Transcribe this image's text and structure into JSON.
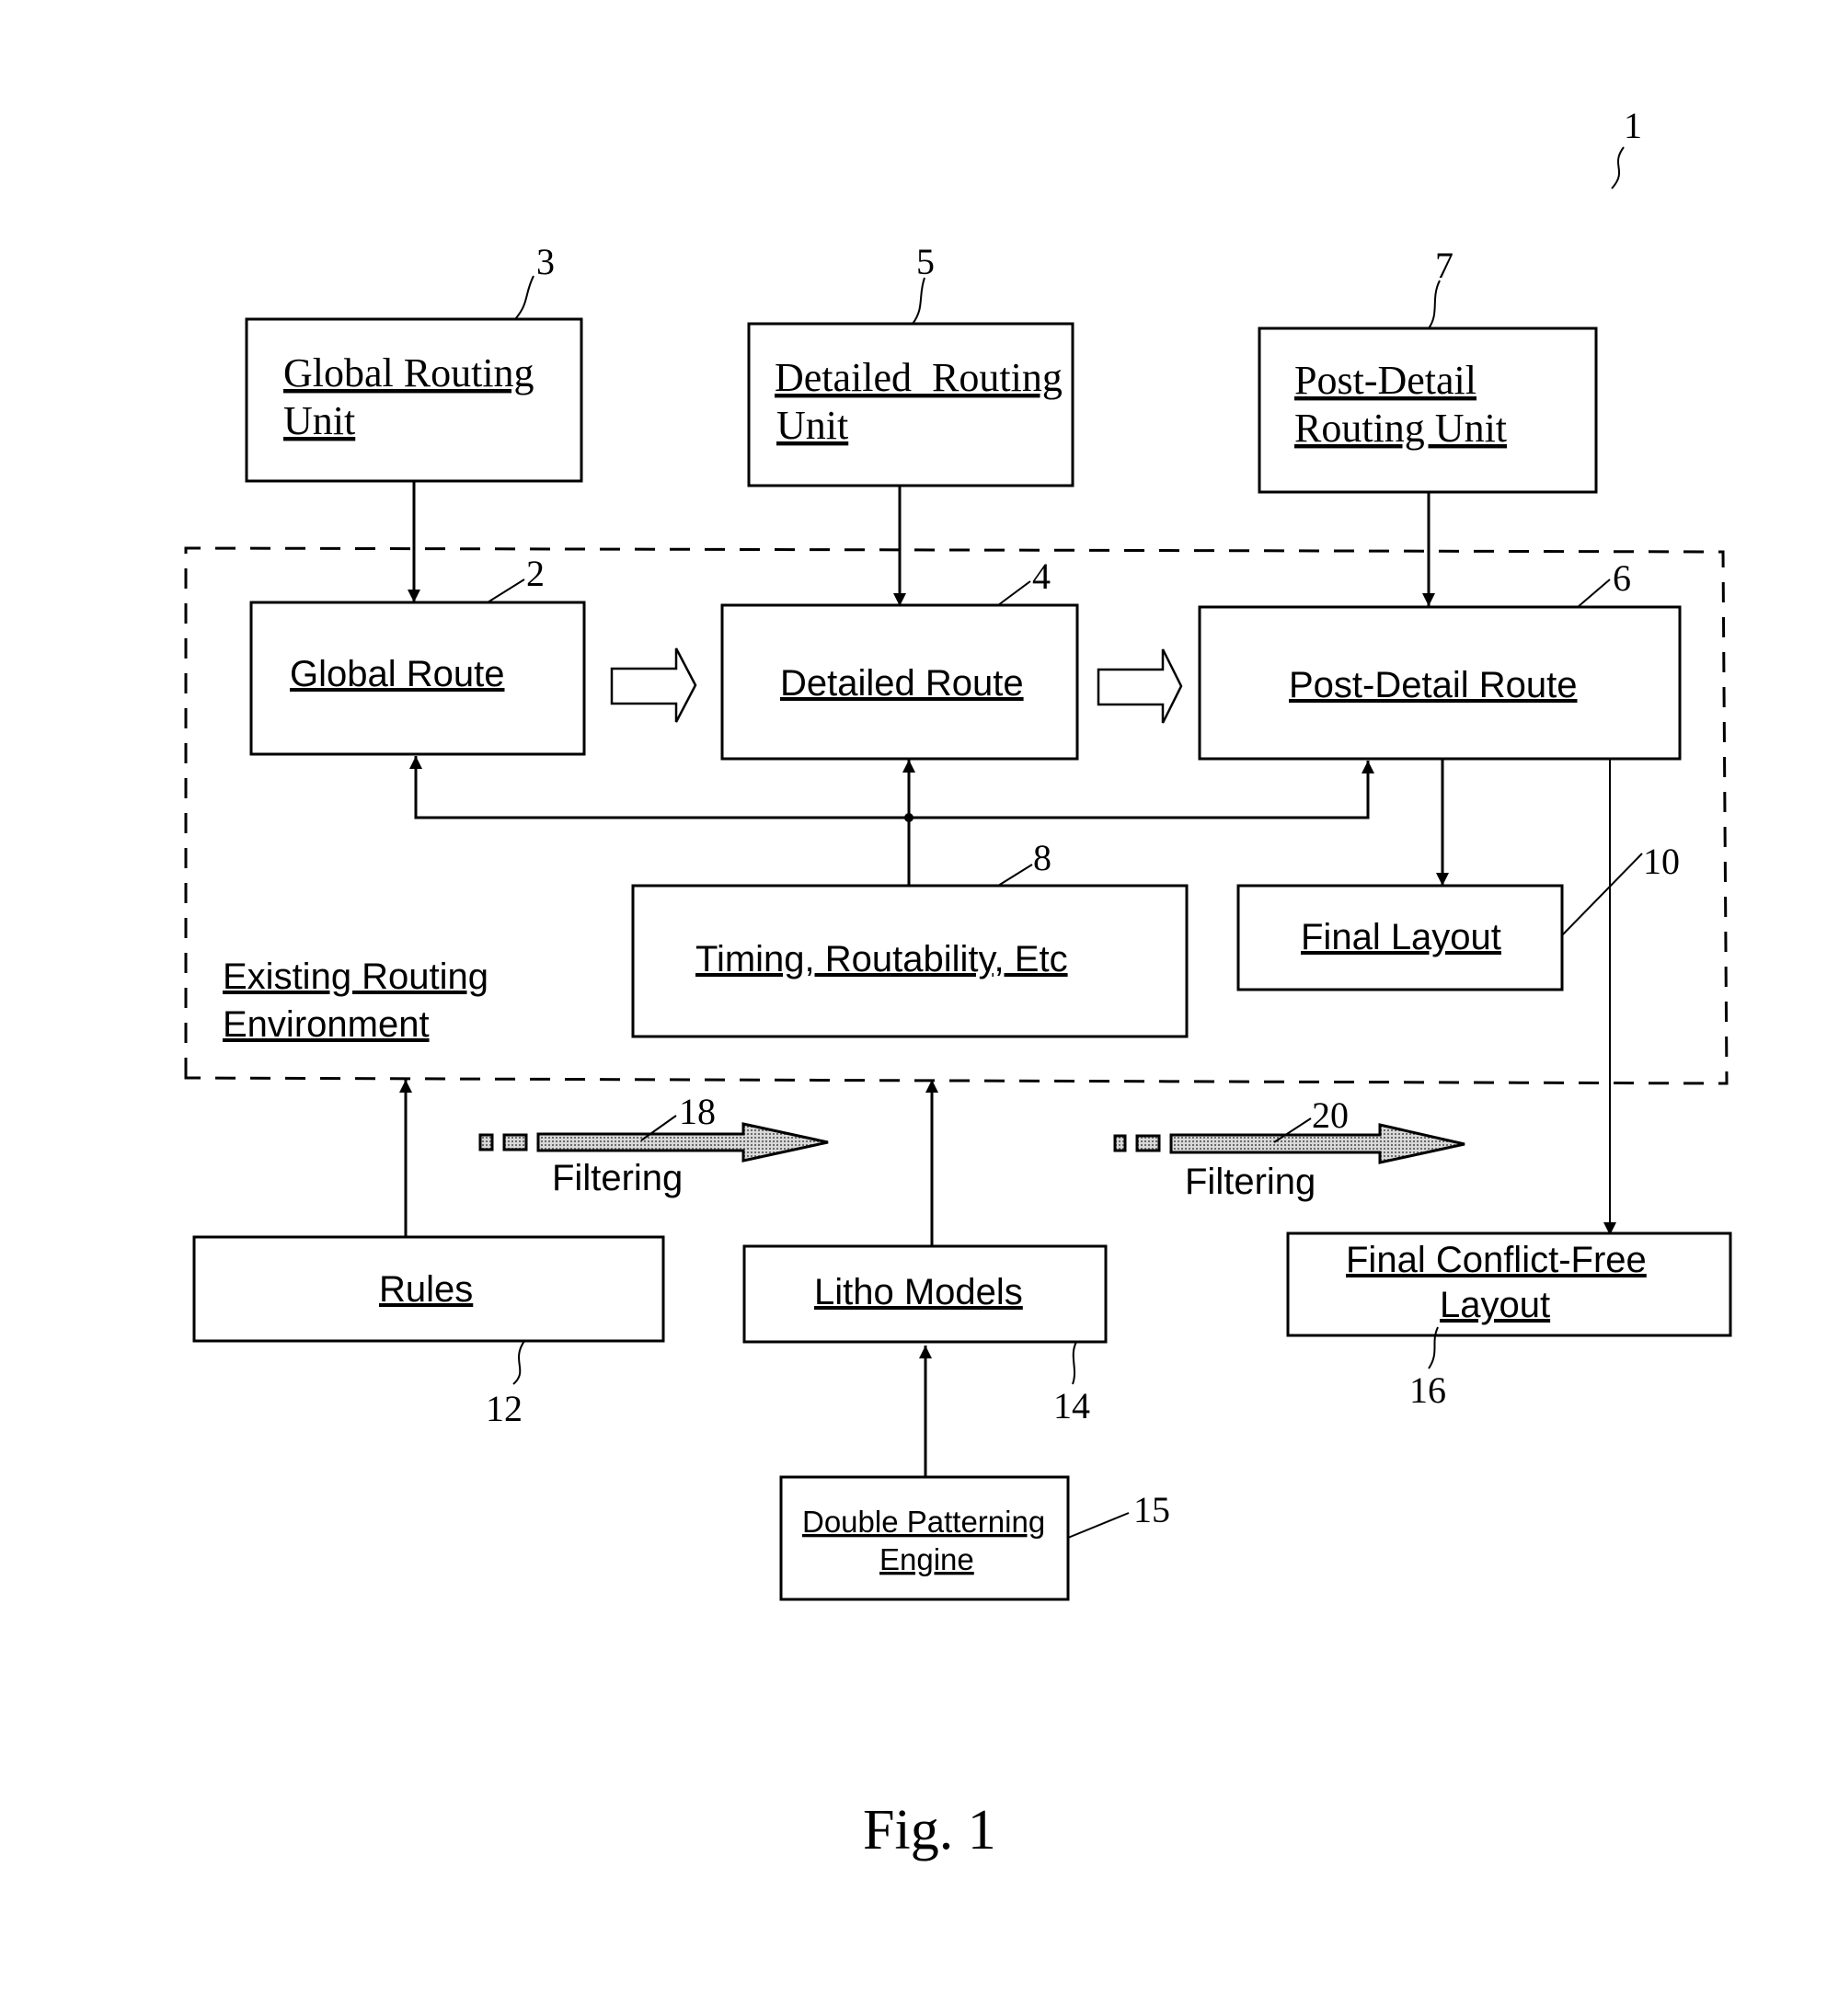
{
  "figure": {
    "caption": "Fig. 1",
    "reference_number": "1"
  },
  "environment": {
    "label_line1": "Existing Routing",
    "label_line2": "Environment"
  },
  "units": {
    "global_routing": {
      "line1": "Global Routing",
      "line2": "Unit",
      "ref": "3"
    },
    "detailed_routing": {
      "line1": "Detailed  Routing",
      "line2": "Unit",
      "ref": "5"
    },
    "post_detail_routing": {
      "line1": "Post-Detail",
      "line2": "Routing Unit",
      "ref": "7"
    }
  },
  "routes": {
    "global": {
      "label": "Global Route",
      "ref": "2"
    },
    "detailed": {
      "label": "Detailed Route",
      "ref": "4"
    },
    "post_detail": {
      "label": "Post-Detail Route",
      "ref": "6"
    }
  },
  "timing": {
    "label": "Timing, Routability, Etc",
    "ref": "8"
  },
  "final_layout": {
    "label": "Final Layout",
    "ref": "10"
  },
  "rules": {
    "label": "Rules",
    "ref": "12"
  },
  "litho_models": {
    "label": "Litho Models",
    "ref": "14"
  },
  "double_patterning": {
    "line1": "Double Patterning",
    "line2": "Engine",
    "ref": "15"
  },
  "conflict_free": {
    "line1": "Final Conflict-Free",
    "line2": "Layout",
    "ref": "16"
  },
  "filters": [
    {
      "label": "Filtering",
      "ref": "18"
    },
    {
      "label": "Filtering",
      "ref": "20"
    }
  ]
}
